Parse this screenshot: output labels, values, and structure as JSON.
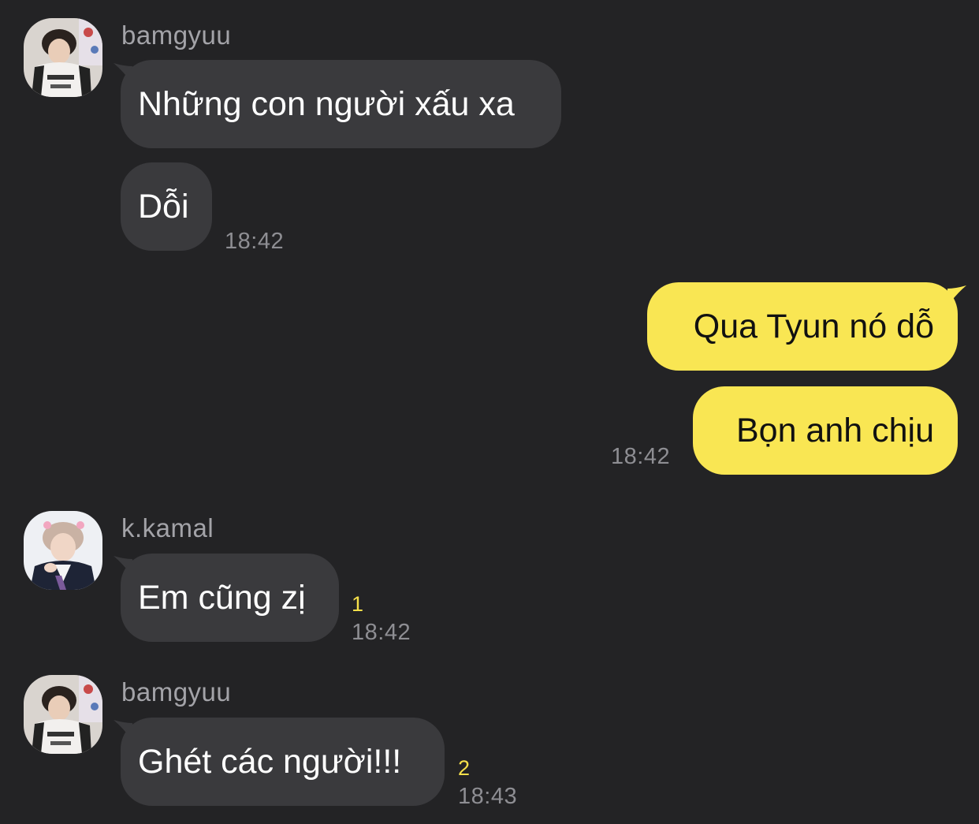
{
  "colors": {
    "background": "#232325",
    "incoming_bubble": "#3a3a3d",
    "outgoing_bubble": "#f9e653",
    "timestamp": "#8e8e93",
    "unread_count": "#f6e04a"
  },
  "messages": {
    "group1": {
      "sender": "bamgyuu",
      "msg1": "Những con người xấu xa",
      "msg2": "Dỗi",
      "time": "18:42"
    },
    "group2": {
      "msg1": "Qua Tyun nó dỗ",
      "msg2": "Bọn anh chịu",
      "time": "18:42"
    },
    "group3": {
      "sender": "k.kamal",
      "msg1": "Em cũng zị",
      "unread": "1",
      "time": "18:42"
    },
    "group4": {
      "sender": "bamgyuu",
      "msg1": "Ghét các người!!!",
      "unread": "2",
      "time": "18:43"
    }
  }
}
